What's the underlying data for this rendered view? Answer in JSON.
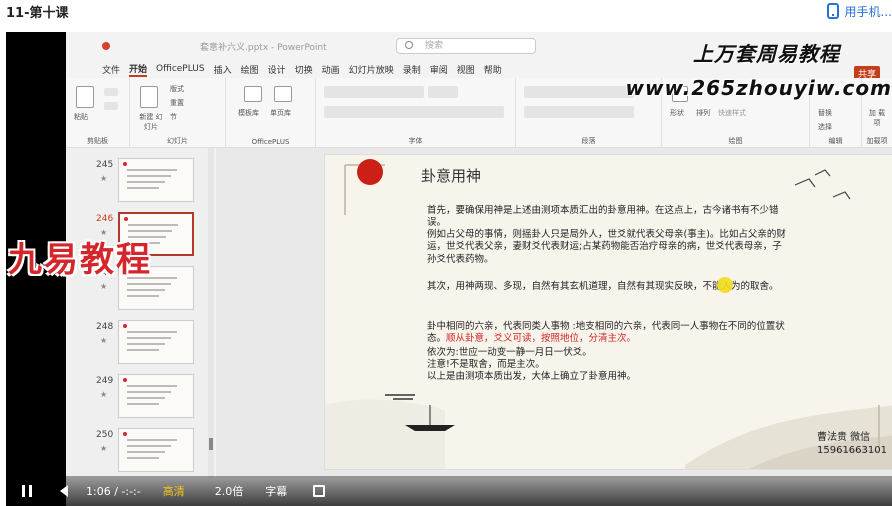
{
  "page": {
    "title": "11-第十课",
    "phone_label": "用手机..."
  },
  "ppt": {
    "filename": "套意补六义.pptx - PowerPoint",
    "search_placeholder": "搜索",
    "menu": [
      "文件",
      "开始",
      "OfficePLUS",
      "插入",
      "绘图",
      "设计",
      "切换",
      "动画",
      "幻灯片放映",
      "录制",
      "审阅",
      "视图",
      "帮助"
    ],
    "active_menu": "开始",
    "share_label": "共享",
    "ribbon_groups": [
      "剪贴板",
      "幻灯片",
      "OfficePLUS",
      "字体",
      "段落",
      "绘图",
      "编辑",
      "加载项"
    ],
    "ribbon_buttons": {
      "paste": "粘贴",
      "new_slide": "新建 幻灯片",
      "layout": "版式",
      "reset": "重置",
      "section": "节",
      "template": "模板库",
      "single": "单页库",
      "shape": "形状",
      "arrange": "排列",
      "quick_style": "快速样式",
      "replace": "替换",
      "select": "选择",
      "addin": "加 载项"
    }
  },
  "watermarks": {
    "brand1": "上万套周易教程",
    "brand2": "www.265zhouyiw.com",
    "brand3": "九易教程"
  },
  "thumbnails": [
    {
      "num": "245",
      "active": false
    },
    {
      "num": "246",
      "active": true
    },
    {
      "num": "247",
      "active": false
    },
    {
      "num": "248",
      "active": false
    },
    {
      "num": "249",
      "active": false
    },
    {
      "num": "250",
      "active": false
    }
  ],
  "slide": {
    "title": "卦意用神",
    "p1": "首先，要确保用神是上述由测项本质汇出的卦意用神。在这点上，古今诸书有不少错误。",
    "p2": "例如占父母的事情，则摇卦人只是局外人，世爻就代表父母亲(事主)。比如占父亲的财运，世爻代表父亲，妻财爻代表财运;占某药物能否治疗母亲的病，世爻代表母亲，子孙爻代表药物。",
    "p3": "其次，用神两现、多现，自然有其玄机道理，自然有其现实反映，不能人为的取舍。",
    "p4a": "卦中相同的六亲，代表同类人事物 :地支相同的六亲，代表同一人事物在不同的位置状态。",
    "p4red": "顺从卦意，爻义可读，按照地位，分清主次。",
    "p5": "依次为:世应一动变一静一月日一伏爻。",
    "p6": "注意!不是取舍，而是主次。",
    "p7": "以上是由测项本质出发，大体上确立了卦意用神。",
    "sig1": "曹法贵  微信",
    "sig2": "15961663101"
  },
  "player": {
    "time": "1:06 / -:-:-",
    "quality": "高清",
    "speed": "2.0倍",
    "subtitles": "字幕"
  }
}
